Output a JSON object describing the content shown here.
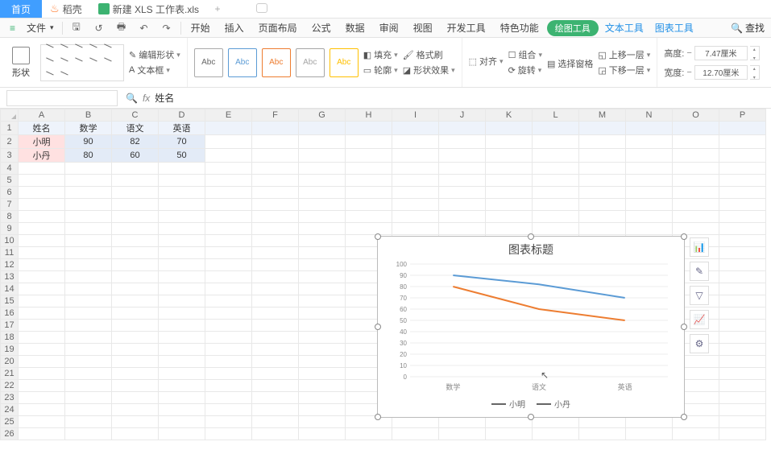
{
  "tabs": {
    "home": "首页",
    "dao": "稻壳",
    "file": "新建 XLS 工作表.xls"
  },
  "menu": {
    "file": "文件",
    "items": [
      "开始",
      "插入",
      "页面布局",
      "公式",
      "数据",
      "审阅",
      "视图",
      "开发工具",
      "特色功能"
    ],
    "active": "绘图工具",
    "text_tool": "文本工具",
    "chart_tool": "图表工具",
    "search": "查找"
  },
  "ribbon": {
    "shape_label": "形状",
    "edit_shape": "编辑形状",
    "textbox": "文本框",
    "abc": "Abc",
    "fill": "填充",
    "outline": "轮廓",
    "format_painter": "格式刷",
    "shape_effect": "形状效果",
    "align": "对齐",
    "group": "组合",
    "rotate": "旋转",
    "select_pane": "选择窗格",
    "move_up": "上移一层",
    "move_down": "下移一层",
    "height_label": "高度:",
    "width_label": "宽度:",
    "height_val": "7.47厘米",
    "width_val": "12.70厘米"
  },
  "formula": {
    "fx": "fx",
    "mag": "🔍",
    "cell_content": "姓名"
  },
  "columns": [
    "A",
    "B",
    "C",
    "D",
    "E",
    "F",
    "G",
    "H",
    "I",
    "J",
    "K",
    "L",
    "M",
    "N",
    "O",
    "P"
  ],
  "rows": 26,
  "table": {
    "headers": [
      "姓名",
      "数学",
      "语文",
      "英语"
    ],
    "rows": [
      [
        "小明",
        "90",
        "82",
        "70"
      ],
      [
        "小丹",
        "80",
        "60",
        "50"
      ]
    ]
  },
  "chart_data": {
    "type": "line",
    "title": "图表标题",
    "categories": [
      "数学",
      "语文",
      "英语"
    ],
    "series": [
      {
        "name": "小明",
        "values": [
          90,
          82,
          70
        ],
        "color": "#5b9bd5"
      },
      {
        "name": "小丹",
        "values": [
          80,
          60,
          50
        ],
        "color": "#ed7d31"
      }
    ],
    "ylim": [
      0,
      100
    ],
    "ytick": 10
  },
  "side_icons": [
    "chart-elements-icon",
    "chart-style-icon",
    "chart-filter-icon",
    "chart-data-icon",
    "chart-settings-icon"
  ]
}
